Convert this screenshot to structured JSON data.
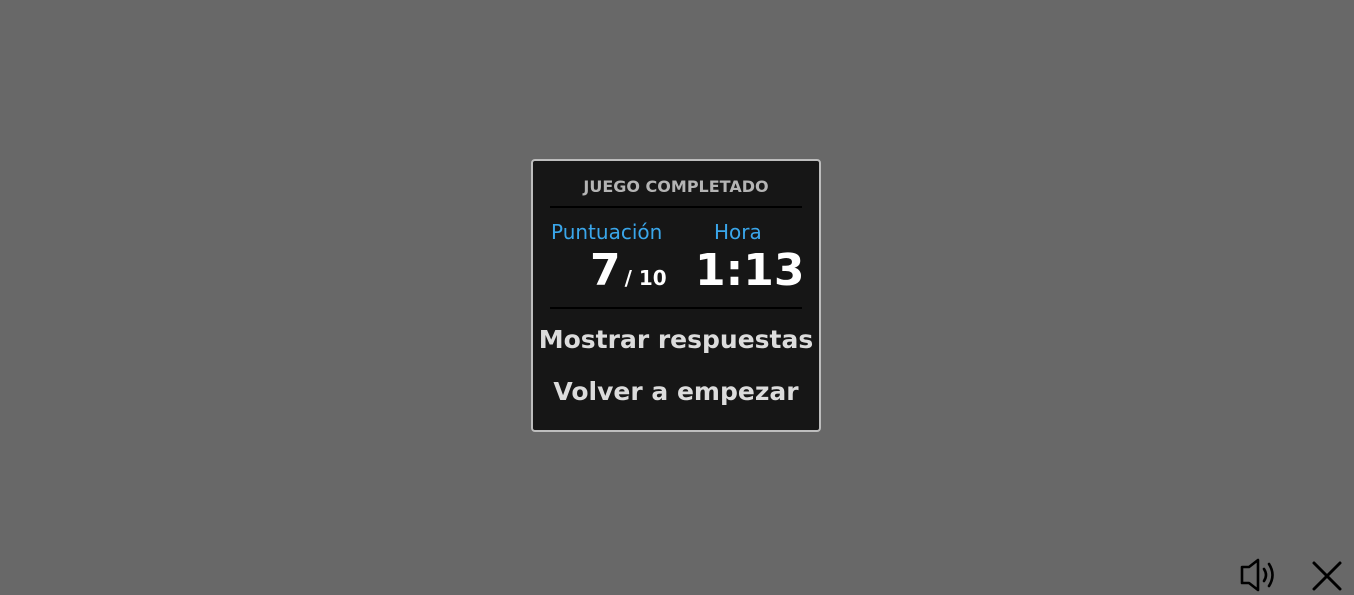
{
  "dialog": {
    "title": "JUEGO COMPLETADO",
    "score_label": "Puntuación",
    "time_label": "Hora",
    "score_value": "7",
    "score_total": "/ 10",
    "time_value": "1:13",
    "show_answers_label": "Mostrar respuestas",
    "restart_label": "Volver a empezar"
  },
  "corner_controls": {
    "sound_icon": "speaker-icon",
    "close_icon": "close-icon"
  },
  "colors": {
    "background": "#686868",
    "dialog_bg": "#161616",
    "accent": "#3aa6ea",
    "text": "#ffffff"
  }
}
